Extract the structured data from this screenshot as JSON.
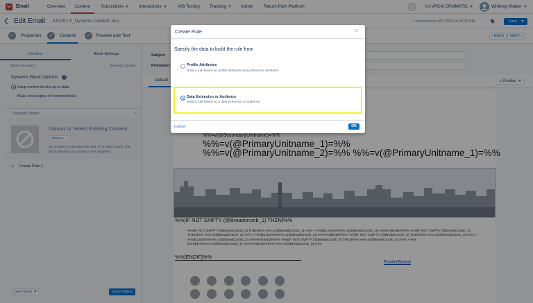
{
  "topnav": {
    "app_name": "Email",
    "items": [
      "Overview",
      "Content",
      "Subscribers",
      "Interactions",
      "A/B Testing",
      "Tracking",
      "Admin",
      "Return Path Platform"
    ],
    "business_unit": "IU-VPCM CRMMKTG",
    "user_name": "Whitney Walker"
  },
  "subheader": {
    "title": "Edit Email",
    "email_name": "IUC001-F_Dynamic Content Test",
    "last_saved": "Last saved on 3/17/2022 at 12:32 PM",
    "save_label": "Save"
  },
  "steps": {
    "items": [
      "Properties",
      "Content",
      "Preview and Test"
    ],
    "back_label": "BACK",
    "next_label": "NEXT"
  },
  "left_panel": {
    "tabs": [
      "Content",
      "Block Settings"
    ],
    "block_not_saved": "Block not saved",
    "block_type": "Dynamic Content",
    "options_title": "Dynamic Block Options",
    "option_keep": "Keep content blocks up-to-date.",
    "option_local": "Make local copies of content blocks.",
    "default_content": "Default Content",
    "upload_title": "Upload or Select Existing Content",
    "browse_label": "Browse...",
    "no_content_text": "No content is currently selected. If no rules match, this block displays no content to the recipient.",
    "create_rule": "Create Rule 1",
    "save_block": "Save Block",
    "done_editing": "Done Editing"
  },
  "right_panel": {
    "subject_label": "Subject",
    "preheader_label": "Preheader",
    "default_tab": "Default",
    "view_mode": "Desktop"
  },
  "canvas": {
    "secondary_unit": "%%=v(@SecondaryUnitname)=%%",
    "primary_1": "%%=v(@PrimaryUnitname_1)=%%",
    "primary_2": "%%=v(@PrimaryUnitname_2)=%% %%=v(@PrimaryUnitname_1)=%%",
    "breadcrumb_if": "%%[IF NOT EMPTY (@Breadcrumb_1) THEN]%%",
    "breadcrumb_code": "%%[IF NOT EMPTY (@BreadCrumb_2) THEN]%% %%=v(@BreadCrumb_1)=%% > %%[ELSE]%%%%=v(@BreadCrumb_1)=%%%%[ENDIF]%% %%[IF NOT EMPTY (@BreadCrumb_3) THEN]%% %%=v(@BreadCrumb_2)=%% > %%[ELSE]%%%%=v(@BreadCrumb_2)=%%%%[ENDIF]%% %%[IF NOT EMPTY (@BreadCrumb_4) THEN]%% %%=v(@BreadCrumb_3)=%% > %%[ELSE]%%%%=v(@BreadCrumb_3)=%%%%[ENDIF]%% %%[IF NOT EMPTY (@BreadCrumb_5) THEN]%% %%=v(@BreadCrumb_4)=%% > %%[ELSE]%%%%=v(@BreadCrumb_4)=%%%%[ENDIF]%% %%=v(@BreadCrumb_5)=%%",
    "endif": "%%[ENDIF]%%",
    "footer_brand": "FooterBrand"
  },
  "modal": {
    "title": "Create Rule",
    "prompt": "Specify the data to build the rule from",
    "option1_title": "Profile Attributes",
    "option1_desc": "Build a rule based on profile attributes and preference attributes.",
    "option2_title": "Data Extension or Audience",
    "option2_desc": "Build a rule based on a data extension or audience",
    "cancel_label": "Cancel",
    "ok_label": "OK",
    "close_glyph": "×",
    "selected_option": "Data Extension or Audience"
  },
  "colors": {
    "brand_red": "#c23934",
    "primary_blue": "#0070d2",
    "highlight_yellow": "#f2f22b"
  }
}
